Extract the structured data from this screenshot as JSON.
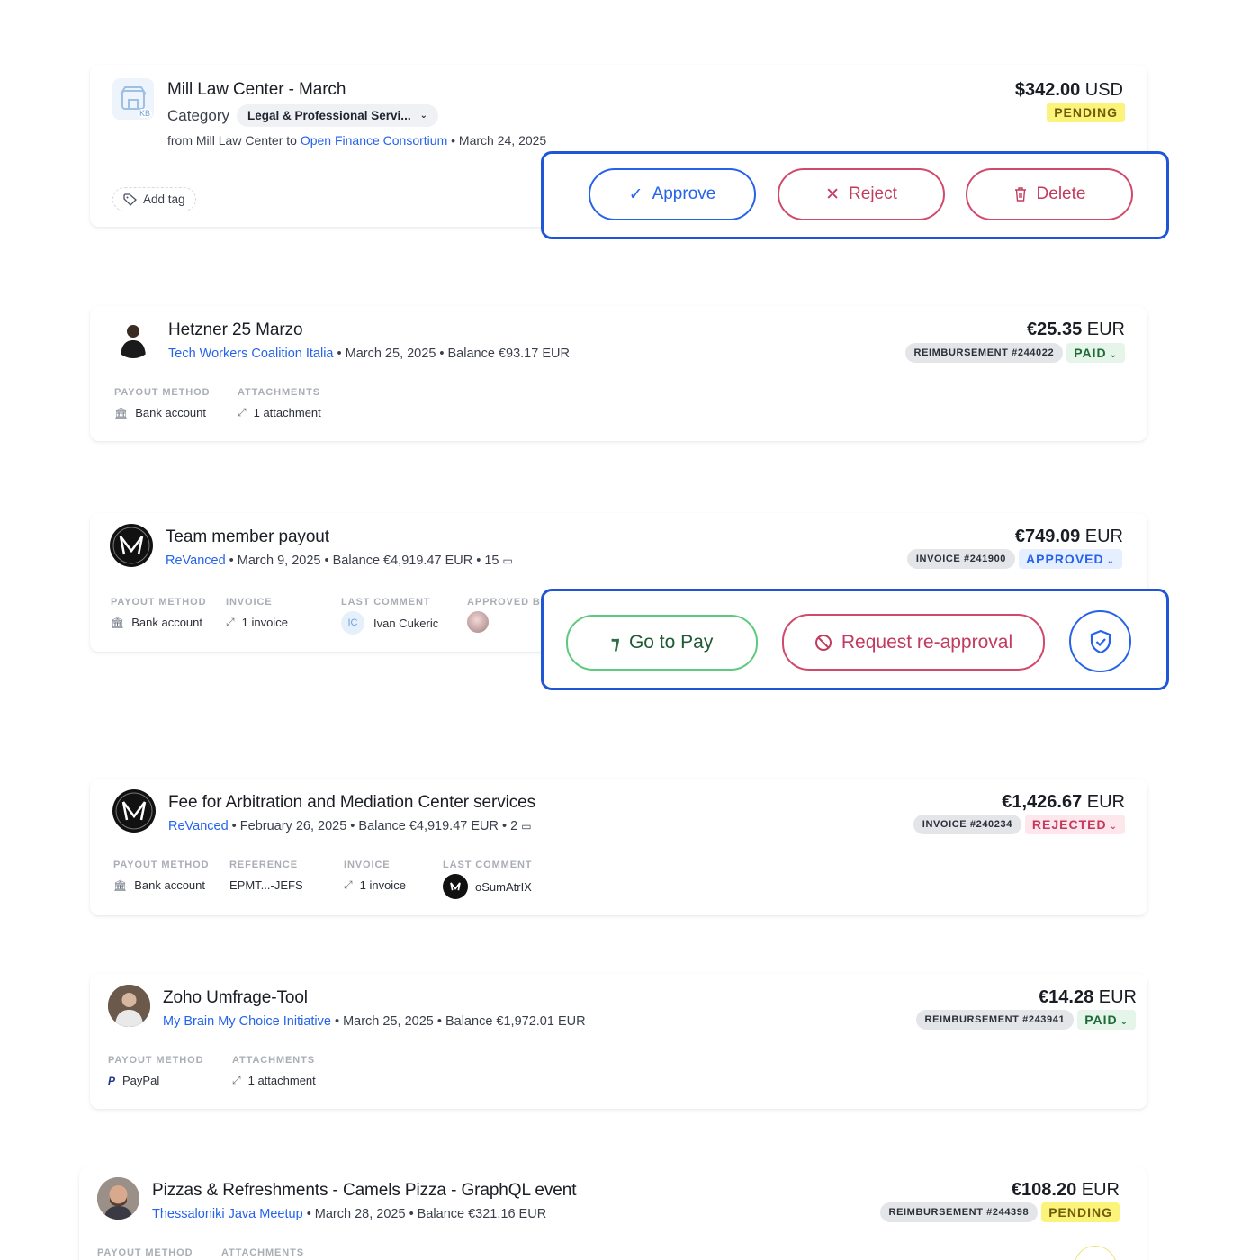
{
  "expenses": [
    {
      "title": "Mill Law Center - March",
      "category_label": "Category",
      "category_value": "Legal & Professional Servi...",
      "meta_from": "from Mill Law Center to",
      "meta_to": "Open Finance Consortium",
      "meta_date": "• March 24, 2025",
      "avatar_initials": "KB",
      "amount": "$342.00",
      "currency": "USD",
      "status": "PENDING",
      "add_tag": "Add tag",
      "actions": {
        "approve": "Approve",
        "reject": "Reject",
        "delete": "Delete"
      }
    },
    {
      "title": "Hetzner 25 Marzo",
      "collective": "Tech Workers Coalition Italia",
      "meta": "• March 25, 2025 • Balance €93.17 EUR",
      "amount": "€25.35",
      "currency": "EUR",
      "ref": "REIMBURSEMENT #244022",
      "status": "PAID",
      "fields": [
        {
          "label": "PAYOUT METHOD",
          "value": "Bank account"
        },
        {
          "label": "ATTACHMENTS",
          "value": "1 attachment"
        }
      ]
    },
    {
      "title": "Team member payout",
      "collective": "ReVanced",
      "meta": "• March 9, 2025 • Balance €4,919.47 EUR • 15",
      "amount": "€749.09",
      "currency": "EUR",
      "ref": "INVOICE #241900",
      "status": "APPROVED",
      "fields": [
        {
          "label": "PAYOUT METHOD",
          "value": "Bank account"
        },
        {
          "label": "INVOICE",
          "value": "1 invoice"
        },
        {
          "label": "LAST COMMENT",
          "value": "Ivan Cukeric",
          "initials": "IC"
        },
        {
          "label": "APPROVED BY",
          "value": ""
        }
      ],
      "actions": {
        "go_to_pay": "Go to Pay",
        "request_reapproval": "Request re-approval"
      }
    },
    {
      "title": "Fee for Arbitration and Mediation Center services",
      "collective": "ReVanced",
      "meta": "• February 26, 2025 • Balance €4,919.47 EUR • 2",
      "amount": "€1,426.67",
      "currency": "EUR",
      "ref": "INVOICE #240234",
      "status": "REJECTED",
      "fields": [
        {
          "label": "PAYOUT METHOD",
          "value": "Bank account"
        },
        {
          "label": "REFERENCE",
          "value": "EPMT...-JEFS"
        },
        {
          "label": "INVOICE",
          "value": "1 invoice"
        },
        {
          "label": "LAST COMMENT",
          "value": "oSumAtrIX"
        }
      ]
    },
    {
      "title": "Zoho Umfrage-Tool",
      "collective": "My Brain My Choice Initiative",
      "meta": "• March 25, 2025 • Balance €1,972.01 EUR",
      "amount": "€14.28",
      "currency": "EUR",
      "ref": "REIMBURSEMENT #243941",
      "status": "PAID",
      "fields": [
        {
          "label": "PAYOUT METHOD",
          "value": "PayPal"
        },
        {
          "label": "ATTACHMENTS",
          "value": "1 attachment"
        }
      ]
    },
    {
      "title": "Pizzas & Refreshments - Camels Pizza - GraphQL event",
      "collective": "Thessaloniki Java Meetup",
      "meta": "• March 28, 2025 • Balance €321.16 EUR",
      "amount": "€108.20",
      "currency": "EUR",
      "ref": "REIMBURSEMENT #244398",
      "status": "PENDING",
      "fields": [
        {
          "label": "PAYOUT METHOD",
          "value": ""
        },
        {
          "label": "ATTACHMENTS",
          "value": ""
        }
      ]
    }
  ],
  "colors": {
    "link": "#2563eb",
    "highlight_border": "#1f56d8",
    "reject": "#c23a5e",
    "go_to_pay_border": "#5fc97e",
    "pending_bg": "#fbf37a"
  }
}
